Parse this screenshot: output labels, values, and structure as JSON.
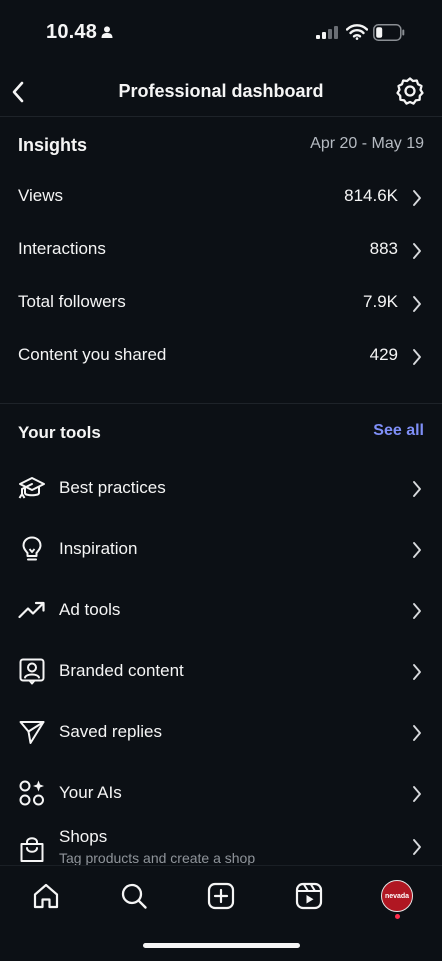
{
  "status_bar": {
    "time": "10.48"
  },
  "header": {
    "title": "Professional dashboard"
  },
  "insights": {
    "title": "Insights",
    "date_range": "Apr 20 - May 19",
    "metrics": [
      {
        "label": "Views",
        "value": "814.6K"
      },
      {
        "label": "Interactions",
        "value": "883"
      },
      {
        "label": "Total followers",
        "value": "7.9K"
      },
      {
        "label": "Content you shared",
        "value": "429"
      }
    ]
  },
  "tools": {
    "title": "Your tools",
    "see_all": "See all",
    "items": [
      {
        "label": "Best practices",
        "icon": "graduation-cap-icon"
      },
      {
        "label": "Inspiration",
        "icon": "lightbulb-icon"
      },
      {
        "label": "Ad tools",
        "icon": "trending-up-icon"
      },
      {
        "label": "Branded content",
        "icon": "branded-content-icon"
      },
      {
        "label": "Saved replies",
        "icon": "send-icon"
      },
      {
        "label": "Your AIs",
        "icon": "ai-shapes-icon"
      },
      {
        "label": "Shops",
        "sublabel": "Tag products and create a shop",
        "icon": "shopping-bag-icon"
      }
    ]
  },
  "nav": {
    "items": [
      "home-icon",
      "search-icon",
      "create-icon",
      "reels-icon",
      "profile-avatar"
    ],
    "avatar_text": "nevada",
    "accent": "#7f8ff7",
    "avatar_color": "#b01722"
  }
}
